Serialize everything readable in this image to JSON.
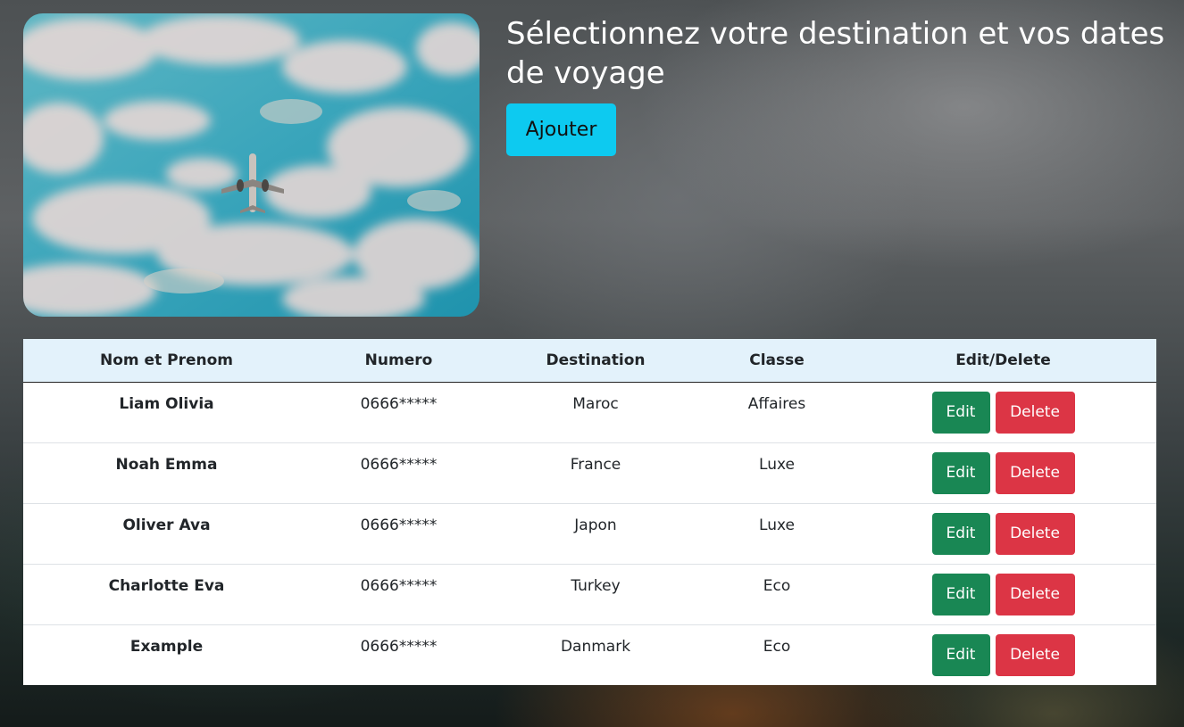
{
  "header": {
    "title": "Sélectionnez votre destination et vos dates de voyage",
    "add_label": "Ajouter"
  },
  "hero": {
    "image_name": "airplane-sky"
  },
  "colors": {
    "add_button": "#0dcaf0",
    "edit_button": "#198754",
    "delete_button": "#dc3545",
    "table_header_bg": "#e3f2fb"
  },
  "table": {
    "columns": [
      "Nom et Prenom",
      "Numero",
      "Destination",
      "Classe",
      "Edit/Delete"
    ],
    "rows": [
      {
        "name": "Liam Olivia",
        "numero": "0666*****",
        "destination": "Maroc",
        "classe": "Affaires",
        "edit": "Edit",
        "delete": "Delete"
      },
      {
        "name": "Noah Emma",
        "numero": "0666*****",
        "destination": "France",
        "classe": "Luxe",
        "edit": "Edit",
        "delete": "Delete"
      },
      {
        "name": "Oliver Ava",
        "numero": "0666*****",
        "destination": "Japon",
        "classe": "Luxe",
        "edit": "Edit",
        "delete": "Delete"
      },
      {
        "name": "Charlotte Eva",
        "numero": "0666*****",
        "destination": "Turkey",
        "classe": "Eco",
        "edit": "Edit",
        "delete": "Delete"
      },
      {
        "name": "Example",
        "numero": "0666*****",
        "destination": "Danmark",
        "classe": "Eco",
        "edit": "Edit",
        "delete": "Delete"
      }
    ]
  }
}
